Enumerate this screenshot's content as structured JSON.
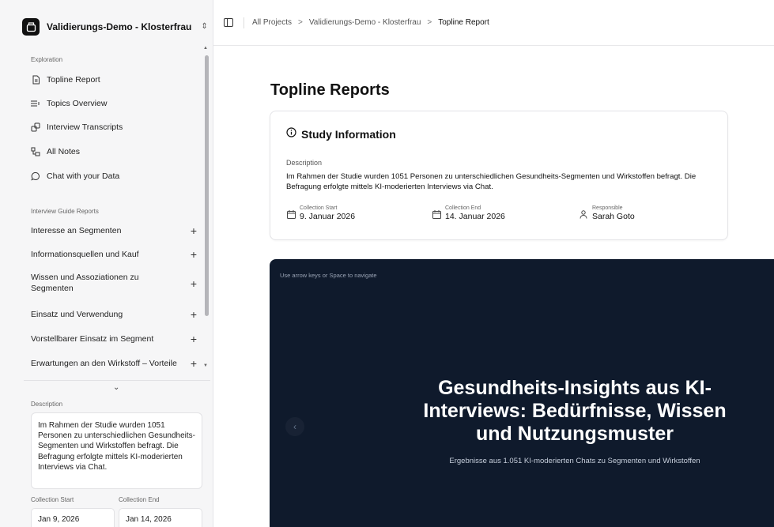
{
  "workspace": {
    "name": "Validierungs-Demo - Klosterfrau"
  },
  "sidebar": {
    "exploration_label": "Exploration",
    "nav": [
      {
        "label": "Topline Report",
        "icon": "document-icon"
      },
      {
        "label": "Topics Overview",
        "icon": "list-icon"
      },
      {
        "label": "Interview Transcripts",
        "icon": "transcript-icon"
      },
      {
        "label": "All Notes",
        "icon": "notes-icon"
      },
      {
        "label": "Chat with your Data",
        "icon": "chat-icon"
      }
    ],
    "guide_label": "Interview Guide Reports",
    "guide_items": [
      {
        "label": "Interesse an Segmenten"
      },
      {
        "label": "Informationsquellen und Kauf"
      },
      {
        "label": "Wissen und Assoziationen zu Segmenten"
      },
      {
        "label": "Einsatz und Verwendung"
      },
      {
        "label": "Vorstellbarer Einsatz im Segment"
      },
      {
        "label": "Erwartungen an den Wirkstoff – Vorteile"
      }
    ],
    "description_label": "Description",
    "description": "Im Rahmen der Studie wurden 1051 Personen zu unterschiedlichen Gesundheits-Segmenten und Wirkstoffen befragt. Die Befragung erfolgte mittels KI-moderierten Interviews via Chat.",
    "collection_start_label": "Collection Start",
    "collection_end_label": "Collection End",
    "collection_start": "Jan 9, 2026",
    "collection_end": "Jan 14, 2026"
  },
  "breadcrumb": {
    "items": [
      "All Projects",
      "Validierungs-Demo - Klosterfrau",
      "Topline Report"
    ],
    "separator": ">"
  },
  "main": {
    "title": "Topline Reports",
    "study": {
      "title": "Study Information",
      "description_label": "Description",
      "description": "Im Rahmen der Studie wurden 1051 Personen zu unterschiedlichen Gesundheits-Segmenten und Wirkstoffen befragt. Die Befragung erfolgte mittels KI-moderierten Interviews via Chat.",
      "collection_start_label": "Collection Start",
      "collection_start": "9. Januar 2026",
      "collection_end_label": "Collection End",
      "collection_end": "14. Januar 2026",
      "responsible_label": "Responsible",
      "responsible": "Sarah Goto"
    },
    "slide": {
      "hint": "Use arrow keys or Space to navigate",
      "title": "Gesundheits-Insights aus KI-Interviews: Bedürfnisse, Wissen und Nutzungsmuster",
      "subtitle": "Ergebnisse aus 1.051 KI-moderierten Chats zu Segmenten und Wirkstoffen",
      "prev_icon": "chevron-left-icon"
    }
  },
  "colors": {
    "slide_bg": "#0f1a2c",
    "sidebar_bg": "#f6f6f7"
  }
}
